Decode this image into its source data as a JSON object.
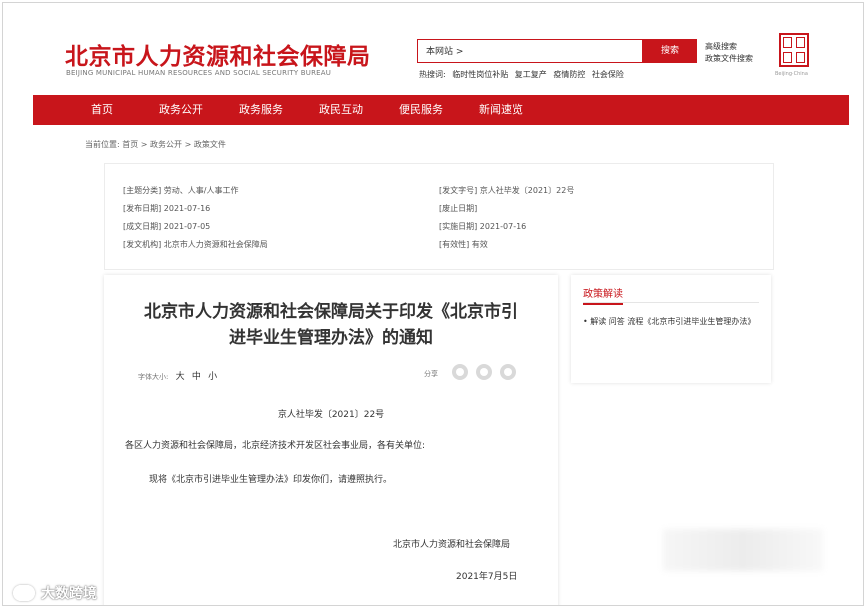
{
  "header": {
    "title": "北京市人力资源和社会保障局",
    "subtitle": "BEIJING MUNICIPAL HUMAN RESOURCES AND SOCIAL SECURITY BUREAU",
    "search_value": "本网站 >",
    "search_button": "搜索",
    "hot_label": "热搜词:",
    "hot_words": [
      "临时性岗位补贴",
      "复工复产",
      "疫情防控",
      "社会保险"
    ],
    "side_links": [
      "高级搜索",
      "政策文件搜索"
    ],
    "seal_caption": "Beijing·China"
  },
  "nav": {
    "items": [
      "首页",
      "政务公开",
      "政务服务",
      "政民互动",
      "便民服务",
      "新闻速览"
    ]
  },
  "breadcrumb": "当前位置:  首页 > 政务公开 > 政策文件",
  "meta": {
    "topic": "[主题分类]  劳动、人事/人事工作",
    "doc_no": "[发文字号]  京人社毕发〔2021〕22号",
    "publish_date": "[发布日期]  2021-07-16",
    "abolish_date": "[废止日期]",
    "created_date": "[成文日期]  2021-07-05",
    "effective_date": "[实施日期]  2021-07-16",
    "issuer": "[发文机构]  北京市人力资源和社会保障局",
    "validity": "[有效性]  有效"
  },
  "article": {
    "title_line1": "北京市人力资源和社会保障局关于印发《北京市引",
    "title_line2": "进毕业生管理办法》的通知",
    "font_label": "字体大小:",
    "font_sizes": [
      "大",
      "中",
      "小"
    ],
    "share_label": "分享",
    "doc_no": "京人社毕发〔2021〕22号",
    "addressee": "各区人力资源和社会保障局，北京经济技术开发区社会事业局，各有关单位:",
    "body": "现将《北京市引进毕业生管理办法》印发你们，请遵照执行。",
    "signature": "北京市人力资源和社会保障局",
    "date": "2021年7月5日"
  },
  "panel": {
    "title": "政策解读",
    "item": "•  解读 问答 流程《北京市引进毕业生管理办法》"
  },
  "watermark": {
    "text": "大数跨境"
  },
  "colors": {
    "brand_red": "#c8151b"
  }
}
